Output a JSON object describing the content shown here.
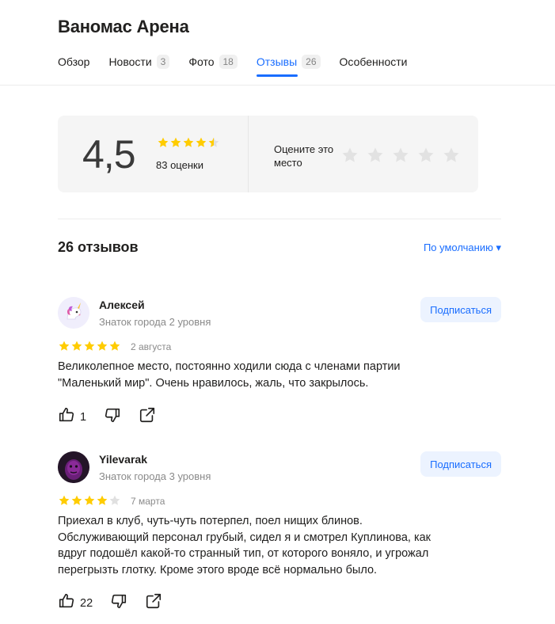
{
  "page": {
    "title": "Ваномас Арена"
  },
  "tabs": [
    {
      "label": "Обзор",
      "count": ""
    },
    {
      "label": "Новости",
      "count": "3"
    },
    {
      "label": "Фото",
      "count": "18"
    },
    {
      "label": "Отзывы",
      "count": "26",
      "active": true
    },
    {
      "label": "Особенности",
      "count": ""
    }
  ],
  "rating": {
    "value": "4,5",
    "stars": 4.5,
    "count_label": "83 оценки",
    "rate_prompt": "Оцените это место",
    "rate_stars": 5
  },
  "reviews_header": {
    "count_label": "26 отзывов",
    "sort_label": "По умолчанию ▾"
  },
  "reviews": [
    {
      "author": "Алексей",
      "level": "Знаток города 2 уровня",
      "subscribe_label": "Подписаться",
      "stars": 5,
      "date": "2 августа",
      "text": "Великолепное место, постоянно ходили сюда с членами партии \"Маленький мир\". Очень нравилось, жаль, что закрылось.",
      "likes": "1",
      "avatar_icon": "unicorn-icon"
    },
    {
      "author": "Yilevarak",
      "level": "Знаток города 3 уровня",
      "subscribe_label": "Подписаться",
      "stars": 4,
      "date": "7 марта",
      "text": "Приехал в клуб, чуть-чуть потерпел, поел нищих блинов. Обслуживающий персонал грубый, сидел я и смотрел Куплинова, как вдруг подошёл какой-то странный тип, от которого воняло, и угрожал перегрызть глотку. Кроме этого вроде всё нормально было.",
      "likes": "22",
      "avatar_icon": "purple-face-icon"
    }
  ],
  "colors": {
    "accent": "#196dff",
    "star_filled": "#fc0",
    "star_empty": "#e0e0e0",
    "text": "#21201f",
    "muted": "#8a8a8a"
  }
}
